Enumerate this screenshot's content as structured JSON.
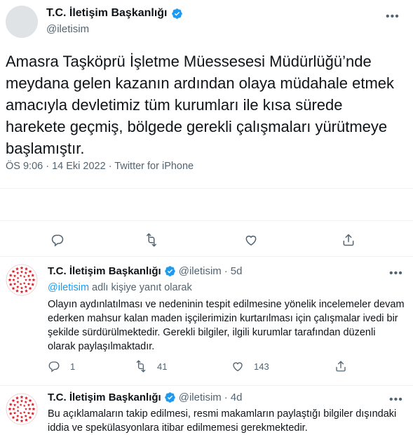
{
  "main": {
    "display_name": "T.C. İletişim Başkanlığı",
    "handle": "@iletisim",
    "text": "Amasra Taşköprü İşletme Müessesesi Müdürlüğü’nde meydana gelen kazanın ardından olaya müdahale etmek amacıyla devletimiz tüm kurumları ile kısa sürede harekete geçmiş, bölgede gerekli çalışmaları yürütmeye başlamıştır.",
    "meta": "ÖS 9:06 · 14 Eki 2022 · Twitter for iPhone",
    "more_icon": "more-icon",
    "actions": [
      "reply-icon",
      "retweet-icon",
      "like-icon",
      "share-icon"
    ]
  },
  "replies": [
    {
      "display_name": "T.C. İletişim Başkanlığı",
      "handle": "@iletisim",
      "dot": "·",
      "time": "5d",
      "reply_to_mention": "@iletisim",
      "reply_to_suffix": " adlı kişiye yanıt olarak",
      "text": "Olayın aydınlatılması ve nedeninin tespit edilmesine yönelik incelemeler devam ederken mahsur kalan maden işçilerimizin kurtarılması için çalışmalar ivedi bir şekilde sürdürülmektedir. Gerekli bilgiler, ilgili kurumlar tarafından düzenli olarak paylaşılmaktadır.",
      "reply_count": "1",
      "retweet_count": "41",
      "like_count": "143"
    },
    {
      "display_name": "T.C. İletişim Başkanlığı",
      "handle": "@iletisim",
      "dot": "·",
      "time": "4d",
      "text": "Bu açıklamaların takip edilmesi, resmi makamların paylaştığı bilgiler dışındaki iddia ve spekülasyonlara itibar edilmemesi gerekmektedir."
    }
  ],
  "colors": {
    "text": "#0f1419",
    "secondary": "#536471",
    "accent": "#1d9bf0",
    "divider": "#eff3f4",
    "logo_red": "#d4202a"
  }
}
